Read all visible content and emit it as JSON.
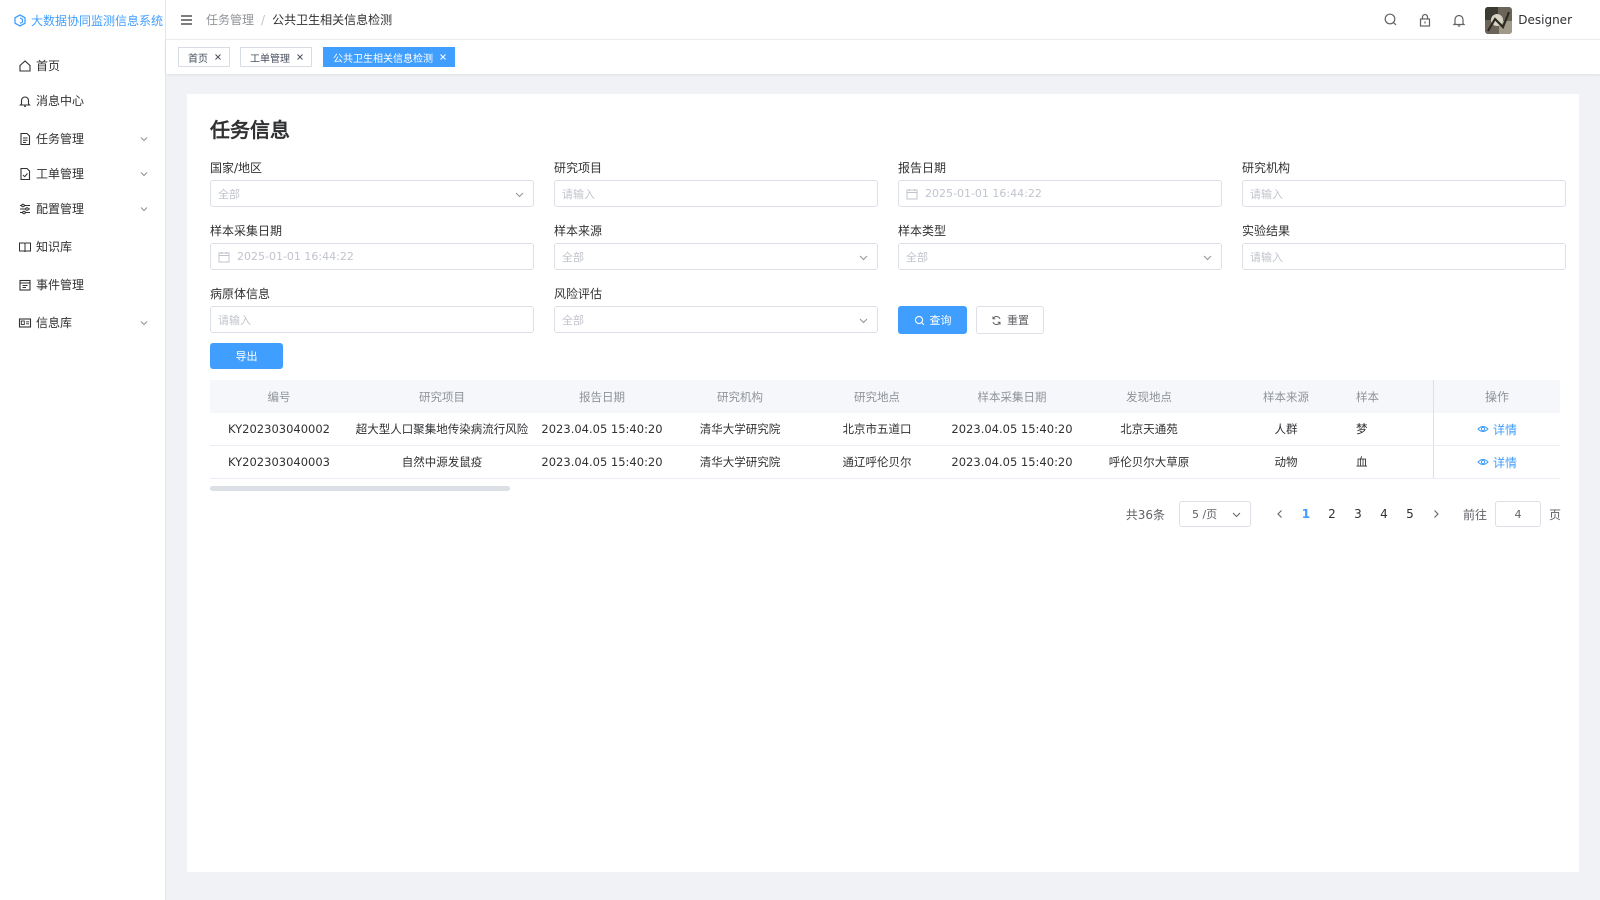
{
  "app": {
    "title": "大数据协同监测信息系统",
    "accent_color": "#409eff"
  },
  "sidebar": {
    "items": [
      {
        "label": "首页",
        "icon": "home-icon",
        "expandable": false
      },
      {
        "label": "消息中心",
        "icon": "bell-icon",
        "expandable": false
      },
      {
        "label": "任务管理",
        "icon": "document-icon",
        "expandable": true
      },
      {
        "label": "工单管理",
        "icon": "file-check-icon",
        "expandable": true
      },
      {
        "label": "配置管理",
        "icon": "sliders-icon",
        "expandable": true
      },
      {
        "label": "知识库",
        "icon": "book-icon",
        "expandable": false
      },
      {
        "label": "事件管理",
        "icon": "calendar-icon",
        "expandable": false
      },
      {
        "label": "信息库",
        "icon": "id-card-icon",
        "expandable": true
      }
    ]
  },
  "header": {
    "breadcrumb": [
      "任务管理",
      "公共卫生相关信息检测"
    ],
    "username": "Designer"
  },
  "tags": [
    {
      "label": "首页",
      "active": false
    },
    {
      "label": "工单管理",
      "active": false
    },
    {
      "label": "公共卫生相关信息检测",
      "active": true
    }
  ],
  "page": {
    "title": "任务信息"
  },
  "filters": {
    "country": {
      "label": "国家/地区",
      "placeholder": "全部"
    },
    "project": {
      "label": "研究项目",
      "placeholder": "请输入"
    },
    "report_date": {
      "label": "报告日期",
      "placeholder": "2025-01-01 16:44:22"
    },
    "institution": {
      "label": "研究机构",
      "placeholder": "请输入"
    },
    "sample_date": {
      "label": "样本采集日期",
      "placeholder": "2025-01-01 16:44:22"
    },
    "sample_source": {
      "label": "样本来源",
      "placeholder": "全部"
    },
    "sample_type": {
      "label": "样本类型",
      "placeholder": "全部"
    },
    "lab_result": {
      "label": "实验结果",
      "placeholder": "请输入"
    },
    "pathogen": {
      "label": "病原体信息",
      "placeholder": "请输入"
    },
    "risk": {
      "label": "风险评估",
      "placeholder": "全部"
    }
  },
  "buttons": {
    "query": "查询",
    "reset": "重置",
    "export": "导出"
  },
  "table": {
    "columns": [
      "编号",
      "研究项目",
      "报告日期",
      "研究机构",
      "研究地点",
      "样本采集日期",
      "发现地点",
      "样本来源",
      "样本",
      "操作"
    ],
    "rows": [
      [
        "KY202303040002",
        "超大型人口聚集地传染病流行风险",
        "2023.04.05 15:40:20",
        "清华大学研究院",
        "北京市五道口",
        "2023.04.05 15:40:20",
        "北京天通苑",
        "人群",
        "梦"
      ],
      [
        "KY202303040003",
        "自然中源发鼠疫",
        "2023.04.05 15:40:20",
        "清华大学研究院",
        "通辽呼伦贝尔",
        "2023.04.05 15:40:20",
        "呼伦贝尔大草原",
        "动物",
        "血"
      ]
    ],
    "action_label": "详情"
  },
  "pagination": {
    "total": "共36条",
    "page_size": "5 /页",
    "pages": [
      "1",
      "2",
      "3",
      "4",
      "5"
    ],
    "current": "1",
    "goto_label": "前往",
    "goto_value": "4",
    "page_suffix": "页"
  }
}
